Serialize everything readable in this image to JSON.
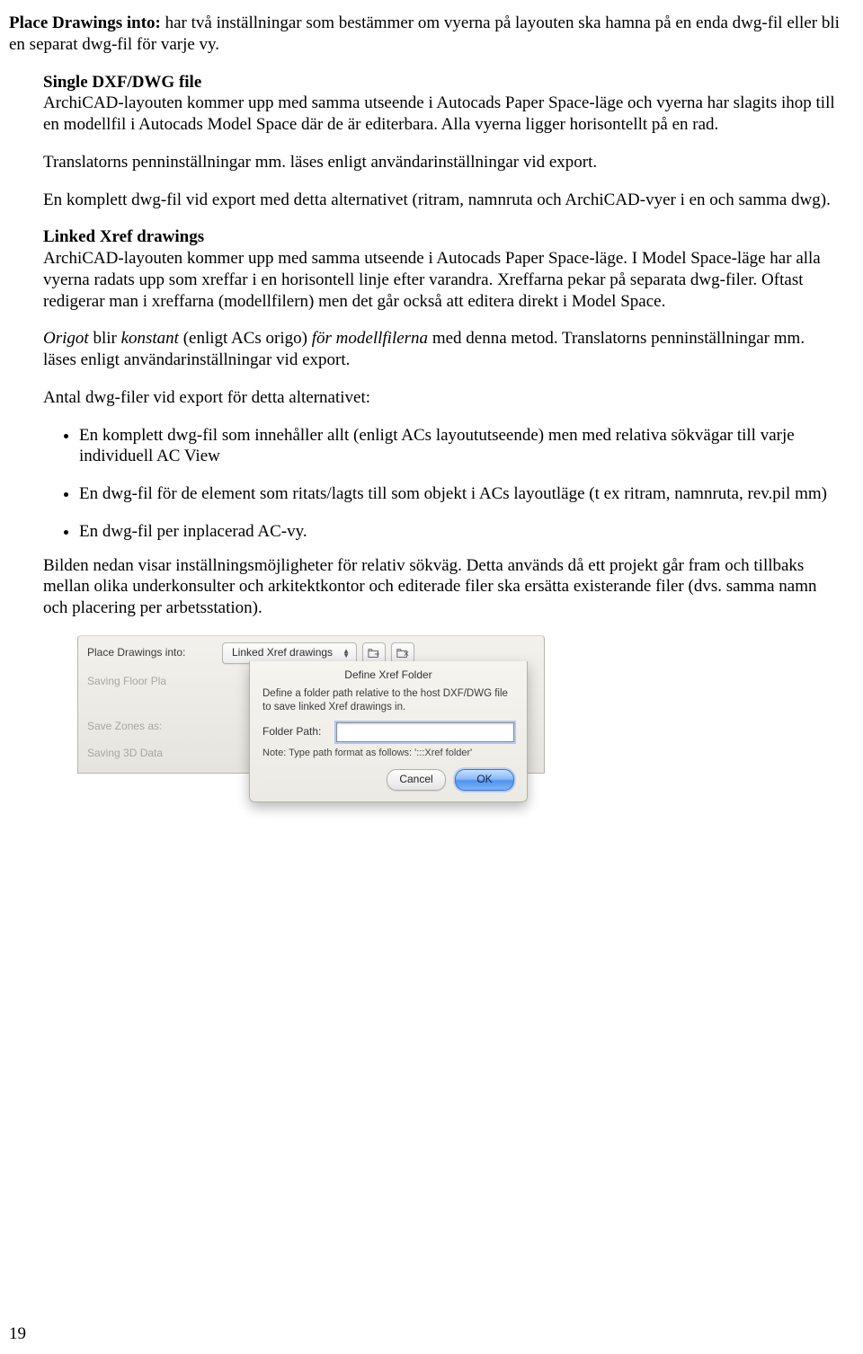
{
  "intro": {
    "lead_bold": "Place Drawings into:",
    "lead_rest": " har två inställningar som bestämmer om vyerna på layouten ska hamna på en enda dwg-fil eller bli en separat dwg-fil för varje vy."
  },
  "single": {
    "heading": "Single DXF/DWG file",
    "p1": "ArchiCAD-layouten kommer upp med samma utseende i Autocads Paper Space-läge och vyerna har slagits ihop till en modellfil i Autocads Model Space där de är editerbara. Alla vyerna ligger horisontellt på en rad.",
    "p2": "Translatorns penninställningar mm. läses enligt användarinställningar vid export.",
    "p3": "En komplett dwg-fil vid export med detta alternativet (ritram, namnruta och ArchiCAD-vyer i en och samma dwg)."
  },
  "linked": {
    "heading": "Linked Xref drawings",
    "p1": "ArchiCAD-layouten kommer upp med samma utseende i Autocads Paper Space-läge. I Model Space-läge har alla vyerna radats upp som xreffar i en horisontell linje efter varandra. Xreffarna pekar på separata dwg-filer. Oftast redigerar man i xreffarna (modellfilern) men det går också att editera direkt i Model Space.",
    "p2_i1": "Origot",
    "p2_t1": " blir ",
    "p2_i2": "konstant",
    "p2_t2": " (enligt ACs origo) ",
    "p2_i3": "för modellfilerna",
    "p2_t3": " med denna metod. Translatorns penninställningar mm. läses enligt användarinställningar vid export.",
    "p3": "Antal dwg-filer vid export för detta alternativet:",
    "bullets": [
      "En komplett dwg-fil som innehåller allt (enligt ACs layoututseende) men med relativa sökvägar till varje individuell AC View",
      "En dwg-fil för de element som ritats/lagts till som objekt i ACs layoutläge (t ex ritram, namnruta, rev.pil mm)",
      "En dwg-fil per inplacerad AC-vy."
    ],
    "p4": "Bilden nedan visar inställningsmöjligheter för relativ sökväg. Detta används då ett projekt går fram och tillbaks mellan olika underkonsulter och arkitektkontor och editerade filer ska ersätta existerande filer (dvs. samma namn och placering per arbetsstation)."
  },
  "dialog": {
    "place_label": "Place Drawings into:",
    "combo_value": "Linked Xref drawings",
    "saving_floor": "Saving Floor Pla",
    "save_zones": "Save Zones as:",
    "saving_3d": "Saving 3D Data",
    "sheet_title": "Define Xref Folder",
    "sheet_desc": "Define a folder path relative to the host DXF/DWG file to save linked Xref drawings in.",
    "folder_label": "Folder Path:",
    "folder_value": "",
    "note": "Note: Type path format as follows:   ':::Xref folder'",
    "cancel": "Cancel",
    "ok": "OK"
  },
  "page_number": "19"
}
